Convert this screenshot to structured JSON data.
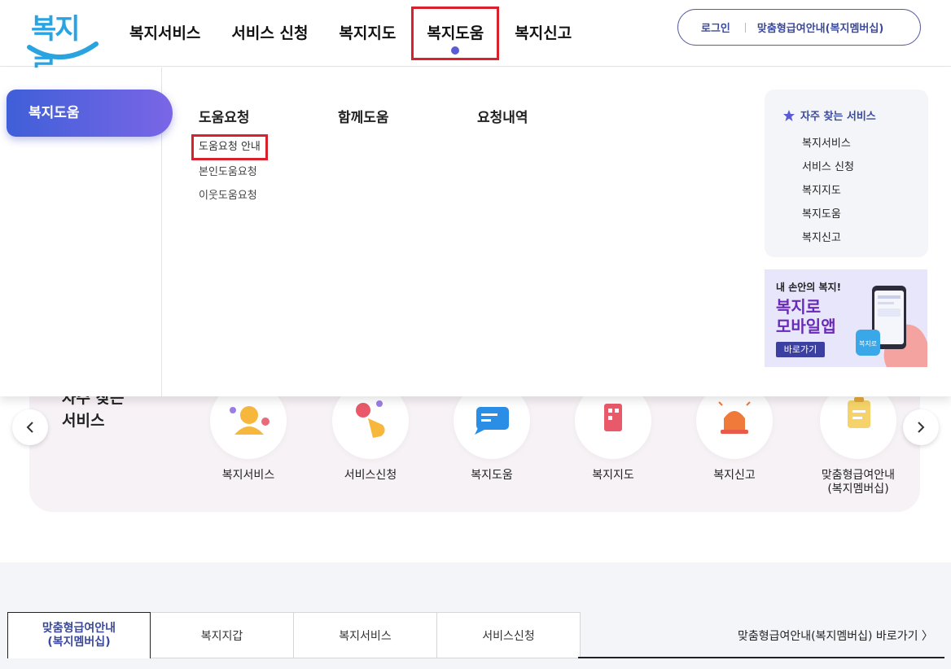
{
  "header": {
    "logo_text": "복지로",
    "gnb": [
      {
        "label": "복지서비스"
      },
      {
        "label": "서비스 신청"
      },
      {
        "label": "복지지도"
      },
      {
        "label": "복지도움"
      },
      {
        "label": "복지신고"
      }
    ],
    "util": {
      "login": "로그인",
      "member": "맞춤형급여안내(복지멤버십)"
    }
  },
  "mega": {
    "active_label": "복지도움",
    "columns": [
      {
        "title": "도움요청",
        "items": [
          "도움요청 안내",
          "본인도움요청",
          "이웃도움요청"
        ]
      },
      {
        "title": "함께도움",
        "items": []
      },
      {
        "title": "요청내역",
        "items": []
      }
    ],
    "favorites": {
      "title": "자주 찾는 서비스",
      "items": [
        "복지서비스",
        "서비스 신청",
        "복지지도",
        "복지도움",
        "복지신고"
      ]
    },
    "banner": {
      "small": "내 손안의 복지!",
      "line1": "복지로",
      "line2": "모바일앱",
      "button": "바로가기",
      "app_icon_text": "복지로"
    }
  },
  "quick": {
    "title_line1": "자주 찾는",
    "title_line2": "서비스",
    "items": [
      {
        "label": "복지서비스",
        "icon": "person-icon"
      },
      {
        "label": "서비스신청",
        "icon": "tap-hand-icon"
      },
      {
        "label": "복지도움",
        "icon": "chat-bubble-icon"
      },
      {
        "label": "복지지도",
        "icon": "building-icon"
      },
      {
        "label": "복지신고",
        "icon": "siren-icon"
      },
      {
        "label_line1": "맞춤형급여안내",
        "label_line2": "(복지멤버십)",
        "icon": "clipboard-icon"
      }
    ]
  },
  "tabs": {
    "items": [
      {
        "label_line1": "맞춤형급여안내",
        "label_line2": "(복지멤버십)"
      },
      {
        "label": "복지지갑"
      },
      {
        "label": "복지서비스"
      },
      {
        "label": "서비스신청"
      }
    ],
    "link": "맞춤형급여안내(복지멤버십) 바로가기 〉"
  }
}
